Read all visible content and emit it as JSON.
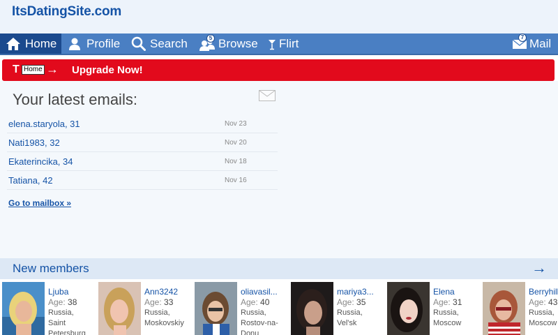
{
  "site": {
    "logo": "ItsDatingSite.com"
  },
  "nav": {
    "items": [
      {
        "label": "Home",
        "icon": "home-icon"
      },
      {
        "label": "Profile",
        "icon": "user-icon"
      },
      {
        "label": "Search",
        "icon": "search-icon"
      },
      {
        "label": "Browse",
        "icon": "users-icon",
        "badge": "5"
      },
      {
        "label": "Flirt",
        "icon": "cocktail-icon"
      },
      {
        "label": "Mail",
        "icon": "envelope-icon",
        "badge": "7"
      }
    ]
  },
  "upgrade": {
    "prefix": "T",
    "tooltip": "Home",
    "arrow": "→",
    "label": "Upgrade Now!"
  },
  "emails": {
    "title": "Your latest emails:",
    "rows": [
      {
        "name": "elena.staryola, 31",
        "date": "Nov 23"
      },
      {
        "name": "Nati1983, 32",
        "date": "Nov 20"
      },
      {
        "name": "Ekaterincika, 34",
        "date": "Nov 18"
      },
      {
        "name": "Tatiana, 42",
        "date": "Nov 16"
      }
    ],
    "mailbox_link": "Go to mailbox »"
  },
  "members": {
    "title": "New members",
    "arrow": "→",
    "age_label": "Age:",
    "list": [
      {
        "name": "Ljuba",
        "age": "38",
        "location": "Russia, Saint Petersburg"
      },
      {
        "name": "Ann3242",
        "age": "33",
        "location": "Russia, Moskovskiy"
      },
      {
        "name": "oliavasil...",
        "age": "40",
        "location": "Russia, Rostov-na-Donu"
      },
      {
        "name": "mariya3...",
        "age": "35",
        "location": "Russia, Vel'sk"
      },
      {
        "name": "Elena",
        "age": "31",
        "location": "Russia, Moscow"
      },
      {
        "name": "Berryhill",
        "age": "43",
        "location": "Russia, Moscow"
      }
    ]
  },
  "colors": {
    "brand": "#1553a6",
    "nav_bg": "#4a7fc3",
    "nav_active": "#1b4a8e",
    "upgrade_bg": "#e20a1c"
  }
}
